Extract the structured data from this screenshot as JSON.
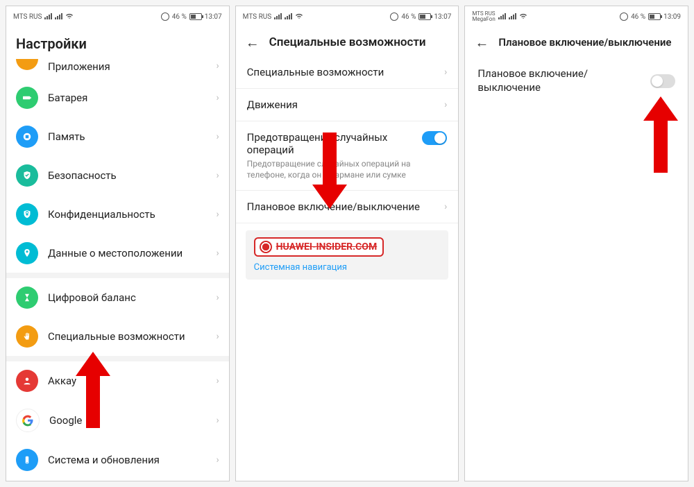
{
  "status": {
    "carrier1": "MTS RUS",
    "carrier2": "MegaFon",
    "battery": "46 %",
    "time1": "13:07",
    "time2": "13:07",
    "time3": "13:09"
  },
  "screen1": {
    "title": "Настройки",
    "items": {
      "apps": "Приложения",
      "battery": "Батарея",
      "memory": "Память",
      "security": "Безопасность",
      "privacy": "Конфиденциальность",
      "location": "Данные о местоположении",
      "digital": "Цифровой баланс",
      "accessibility": "Специальные возможности",
      "account": "Аккау",
      "google": "Google",
      "system": "Система и обновления"
    }
  },
  "screen2": {
    "title": "Специальные возможности",
    "items": {
      "accessibility": "Специальные возможности",
      "gestures": "Движения",
      "prevent_title": "Предотвращение случайных операций",
      "prevent_desc": "Предотвращение случайных операций на телефоне, когда он в кармане или сумке",
      "scheduled": "Плановое включение/выключение",
      "watermark": "HUAWEI-INSIDER.COM",
      "nav_link": "Системная навигация"
    }
  },
  "screen3": {
    "title": "Плановое включение/выключение",
    "toggle_label": "Плановое включение/выключение"
  },
  "colors": {
    "orange": "#f39c12",
    "green": "#2ecc71",
    "blue": "#1e9df7",
    "teal": "#1abc9c",
    "cyan": "#00bcd4",
    "red": "#e53935"
  }
}
